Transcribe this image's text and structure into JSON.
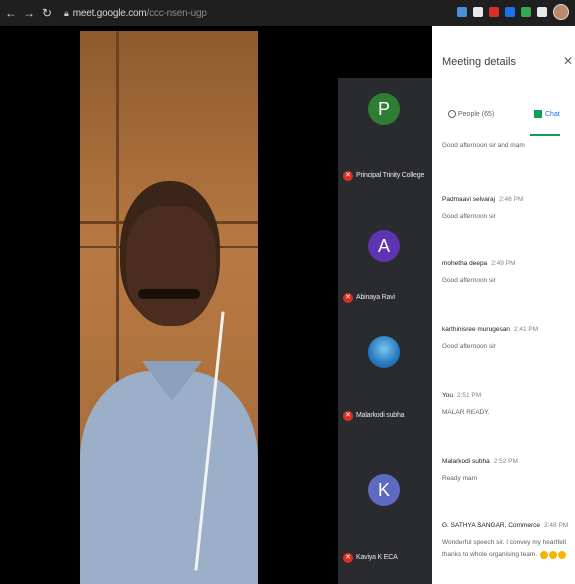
{
  "browser": {
    "url_domain": "meet.google.com",
    "url_path": "/ccc-nsen-ugp"
  },
  "participants": [
    {
      "initial": "P",
      "name": "Principal Trinity College",
      "color": "#2e7d32"
    },
    {
      "initial": "A",
      "name": "Abinaya Ravi",
      "color": "#5e35b1"
    },
    {
      "initial": "",
      "name": "Malarkodi subha",
      "avatar": "landscape"
    },
    {
      "initial": "K",
      "name": "Kaviya K ECA",
      "color": "#5c6bc0"
    }
  ],
  "panel": {
    "title": "Meeting details",
    "tabs": {
      "people": "People (65)",
      "chat": "Chat"
    }
  },
  "messages": [
    {
      "sender": "",
      "time": "",
      "text": "Good afternoon sir and mam"
    },
    {
      "sender": "Padmaavi selvaraj",
      "time": "2:46 PM",
      "text": "Good afternoon sir"
    },
    {
      "sender": "mohetha deepa",
      "time": "2:49 PM",
      "text": "Good afternoon sir"
    },
    {
      "sender": "karthinisree murugesan",
      "time": "2:41 PM",
      "text": "Good afternoon sir"
    },
    {
      "sender": "You",
      "time": "2:51 PM",
      "text": "MALAR READY."
    },
    {
      "sender": "Malarkodi subha",
      "time": "2:52 PM",
      "text": "Ready mam"
    },
    {
      "sender": "G. SATHYA SANGAR, Commerce",
      "time": "3:48 PM",
      "text": "Wonderful speech sir. I convey my heartfelt thanks to whole organising team."
    }
  ]
}
